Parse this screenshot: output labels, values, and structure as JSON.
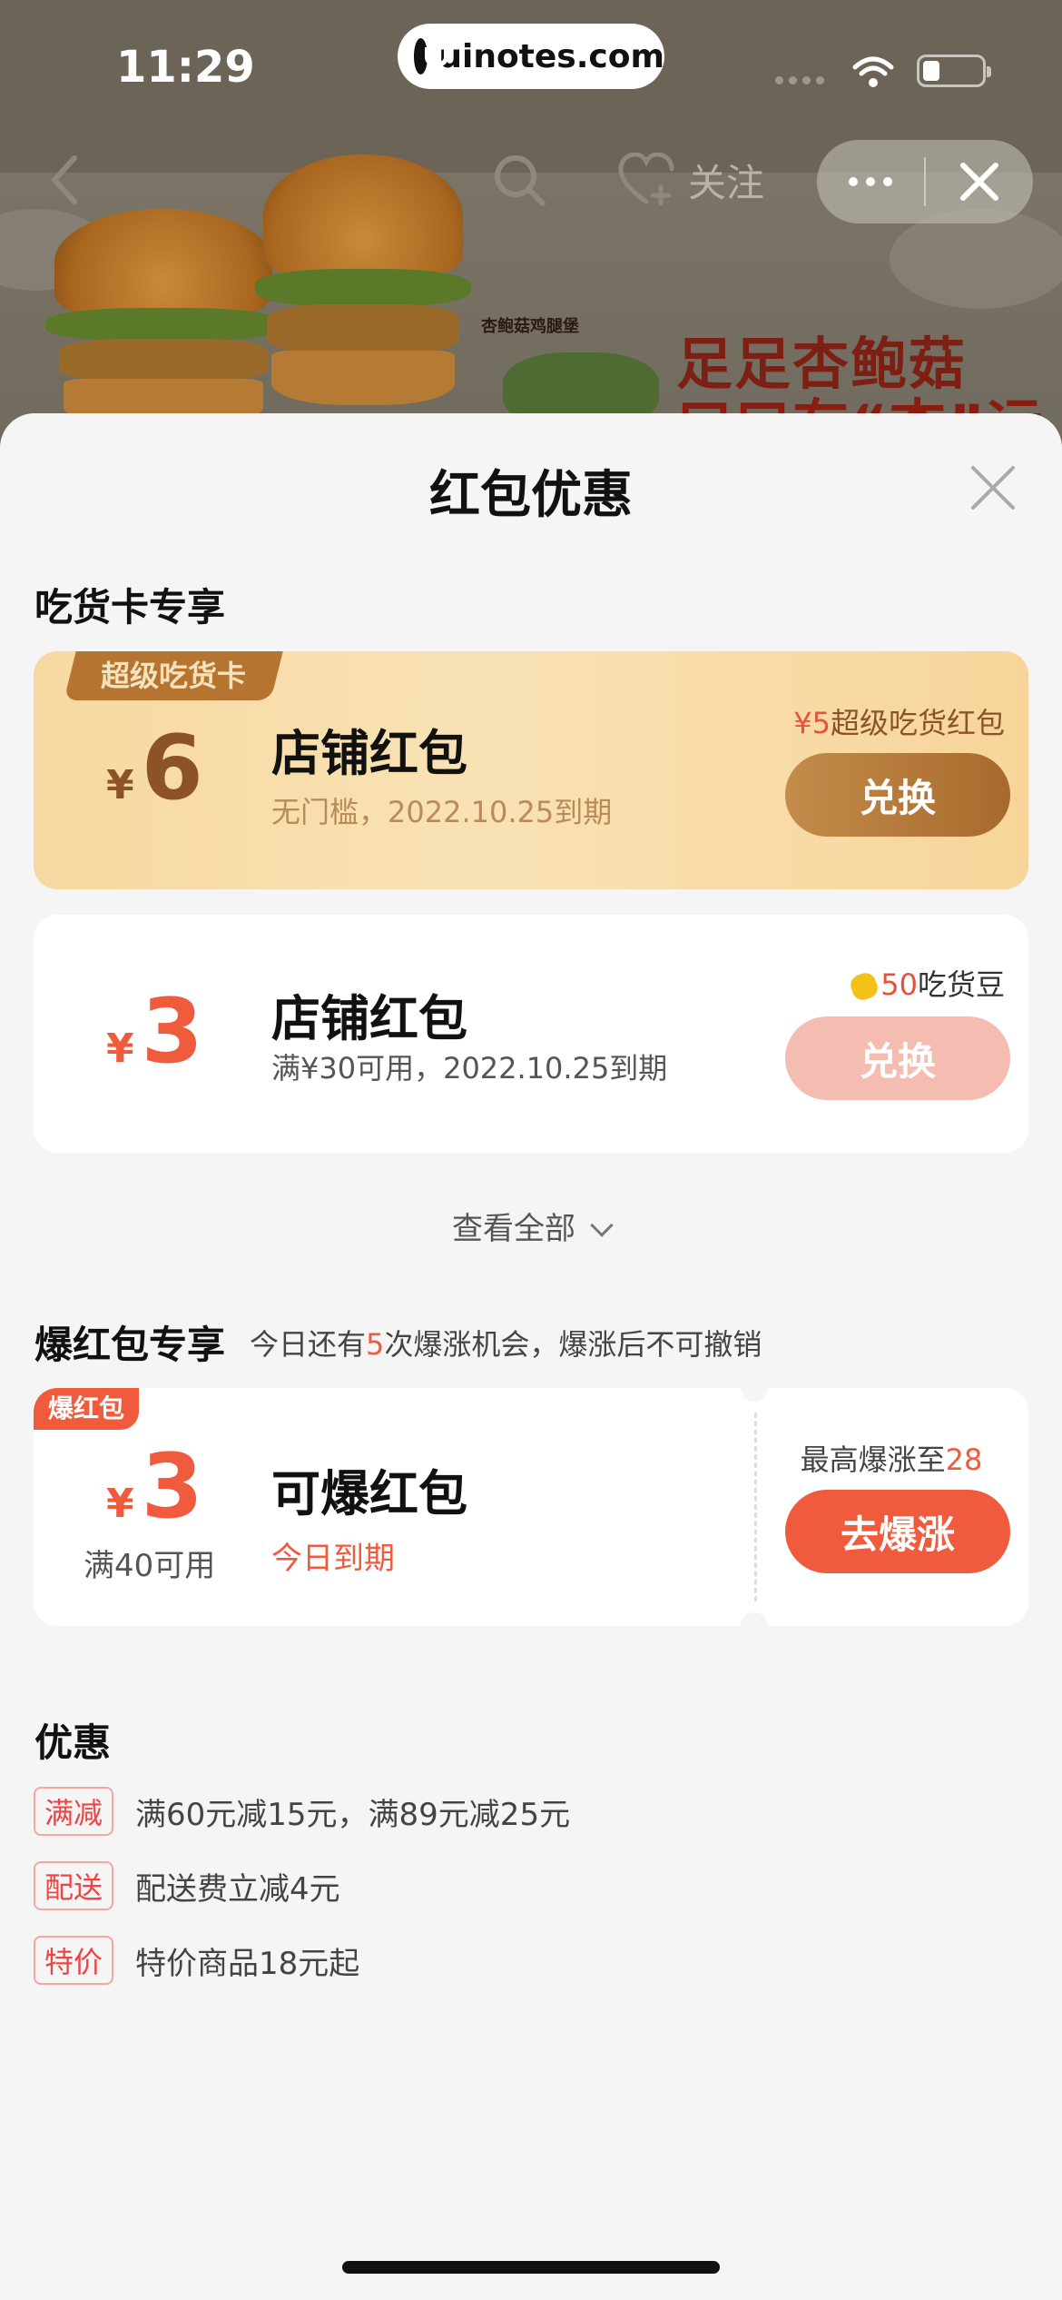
{
  "status_bar": {
    "time": "11:29",
    "url": "uinotes.com"
  },
  "nav": {
    "follow_label": "关注"
  },
  "banner": {
    "headline_1": "足足杏鲍菇",
    "headline_2": "口口有“杏”运",
    "small_label": "杏鲍菇鸡腿堡"
  },
  "sheet": {
    "title": "红包优惠",
    "foodie_section": {
      "title": "吃货卡专享",
      "cards": [
        {
          "ribbon": "超级吃货卡",
          "currency": "¥",
          "amount": "6",
          "name": "店铺红包",
          "desc": "无门槛，2022.10.25到期",
          "price_prefix": "¥5",
          "price_suffix": "超级吃货红包",
          "button": "兑换"
        },
        {
          "currency": "¥",
          "amount": "3",
          "name": "店铺红包",
          "desc": "满¥30可用，2022.10.25到期",
          "price_prefix": "50",
          "price_suffix": "吃货豆",
          "button": "兑换"
        }
      ],
      "view_all": "查看全部"
    },
    "boom_section": {
      "title": "爆红包专享",
      "subtitle_before": "今日还有",
      "subtitle_count": "5",
      "subtitle_after": "次爆涨机会，爆涨后不可撤销",
      "card": {
        "ribbon": "爆红包",
        "currency": "¥",
        "amount": "3",
        "condition": "满40可用",
        "name": "可爆红包",
        "expiry": "今日到期",
        "max_label": "最高爆涨至",
        "max_value": "28",
        "button": "去爆涨"
      }
    },
    "promo_section": {
      "title": "优惠",
      "items": [
        {
          "tag": "满减",
          "text": "满60元减15元，满89元减25元"
        },
        {
          "tag": "配送",
          "text": "配送费立减4元"
        },
        {
          "tag": "特价",
          "text": "特价商品18元起"
        }
      ]
    }
  },
  "colors": {
    "accent_red": "#ef5b3c",
    "gold_button": "#b57a34",
    "light_red_button": "#f5bcb2"
  }
}
